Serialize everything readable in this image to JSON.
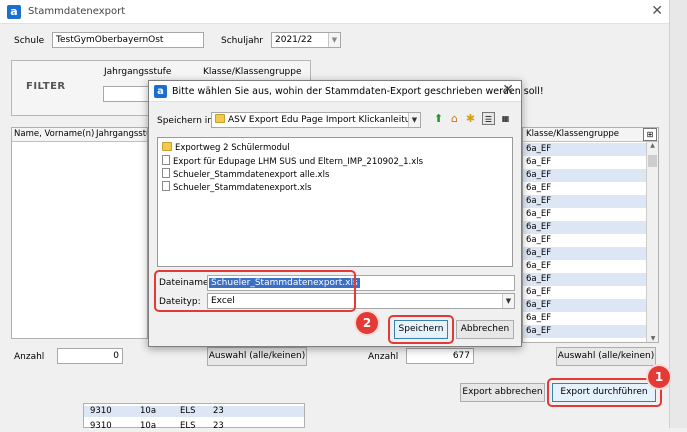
{
  "window": {
    "title": "Stammdatenexport"
  },
  "header": {
    "schule_label": "Schule",
    "schule_value": "TestGymOberbayernOst",
    "schuljahr_label": "Schuljahr",
    "schuljahr_value": "2021/22"
  },
  "filter": {
    "label": "FILTER",
    "jahrgangsstufe_label": "Jahrgangsstufe",
    "klasse_label": "Klasse/Klassengruppe"
  },
  "left_table": {
    "headers": [
      "Name, Vorname(n)",
      "Jahrgangsstufe"
    ]
  },
  "right_table": {
    "header": "Klasse/Klassengruppe",
    "rows": [
      "6a_EF",
      "6a_EF",
      "6a_EF",
      "6a_EF",
      "6a_EF",
      "6a_EF",
      "6a_EF",
      "6a_EF",
      "6a_EF",
      "6a_EF",
      "6a_EF",
      "6a_EF",
      "6a_EF",
      "6a_EF",
      "6a_EF"
    ]
  },
  "footer": {
    "anzahl_label": "Anzahl",
    "anzahl_left": "0",
    "auswahl_left": "Auswahl (alle/keinen)",
    "anzahl_right": "677",
    "auswahl_right": "Auswahl (alle/keinen)",
    "export_abbrechen": "Export abbrechen",
    "export_durchfuehren": "Export durchführen"
  },
  "bottom_rows": [
    {
      "c1": "9310",
      "c2": "10a",
      "c3": "ELS",
      "c4": "23"
    },
    {
      "c1": "9310",
      "c2": "10a",
      "c3": "ELS",
      "c4": "23"
    }
  ],
  "dialog": {
    "title": "Bitte wählen Sie aus, wohin der Stammdaten-Export geschrieben werden soll!",
    "speichern_in_label": "Speichern in:",
    "speichern_in_value": "ASV Export Edu Page Import Klickanleitung",
    "files": [
      {
        "name": "Exportweg 2 Schülermodul",
        "kind": "folder"
      },
      {
        "name": "Export für Edupage LHM SUS und Eltern_IMP_210902_1.xls",
        "kind": "file"
      },
      {
        "name": "Schueler_Stammdatenexport alle.xls",
        "kind": "file"
      },
      {
        "name": "Schueler_Stammdatenexport.xls",
        "kind": "file"
      }
    ],
    "dateiname_label": "Dateiname:",
    "dateiname_value": "Schueler_Stammdatenexport.xls",
    "dateityp_label": "Dateityp:",
    "dateityp_value": "Excel",
    "speichern_button": "Speichern",
    "abbrechen_button": "Abbrechen"
  },
  "badges": {
    "step1": "1",
    "step2": "2"
  },
  "colors": {
    "accent": "#1a6fd1",
    "highlight": "#e53935",
    "row_alt": "#dde6f4",
    "selection": "#3a6fc4"
  }
}
